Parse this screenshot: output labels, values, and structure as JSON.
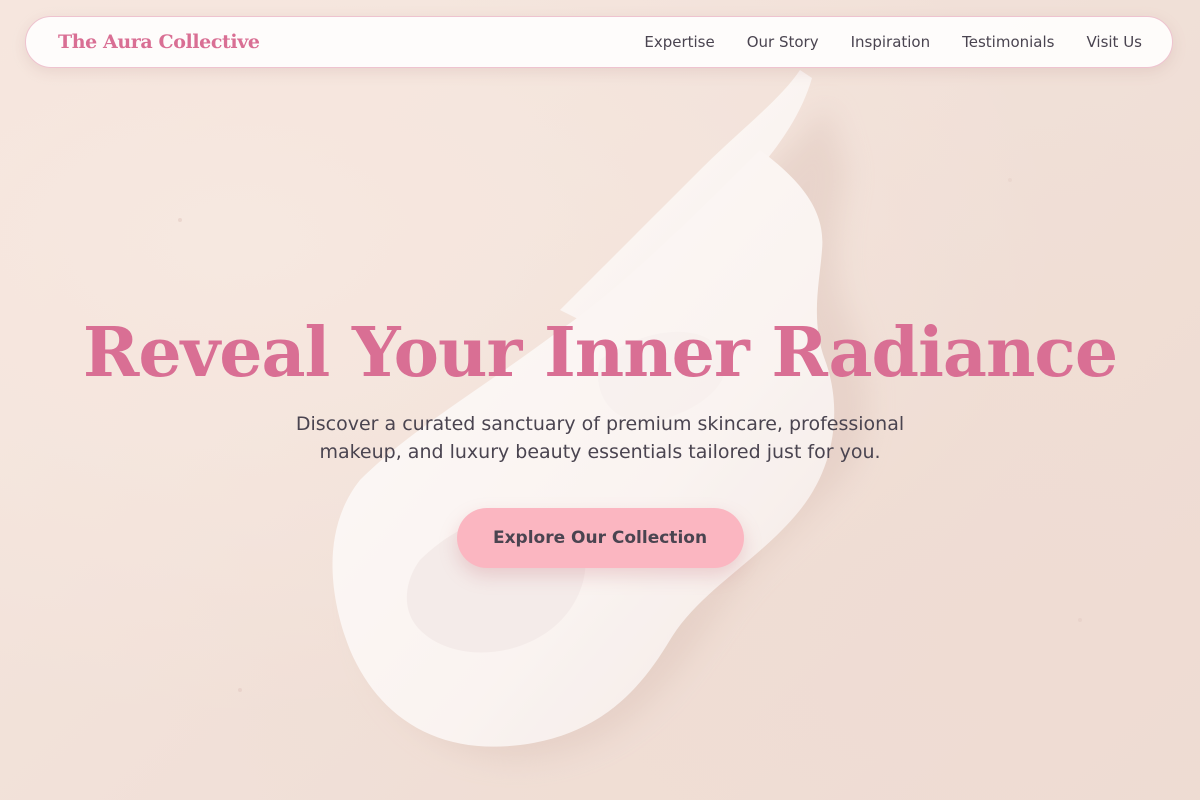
{
  "navbar": {
    "brand": "The Aura Collective",
    "links": [
      {
        "label": "Expertise"
      },
      {
        "label": "Our Story"
      },
      {
        "label": "Inspiration"
      },
      {
        "label": "Testimonials"
      },
      {
        "label": "Visit Us"
      }
    ]
  },
  "hero": {
    "title": "Reveal Your Inner Radiance",
    "subtitle": "Discover a curated sanctuary of premium skincare, professional makeup, and luxury beauty essentials tailored just for you.",
    "cta_label": "Explore Our Collection",
    "background_image": "cream-swatch-image"
  },
  "colors": {
    "accent": "#d96f94",
    "button": "#fbb6c1",
    "text": "#4a4450",
    "background": "#f1dfd6"
  }
}
